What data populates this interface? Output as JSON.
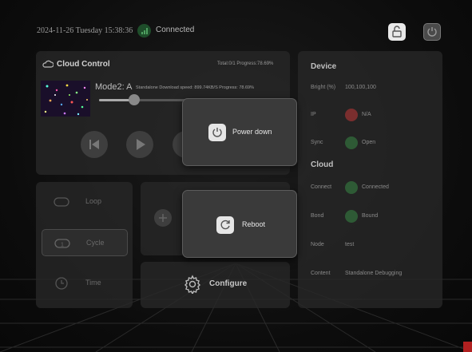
{
  "header": {
    "datetime": "2024-11-26 Tuesday 15:38:36",
    "connection": "Connected"
  },
  "cloud_control": {
    "title": "Cloud Control",
    "total_progress": "Total:0/1  Progress:78.69%",
    "mode_label": "Mode2: A",
    "mode_detail": "Standalone Download speed: 899.74KB/S Progress: 78.69%",
    "progress": 0.21
  },
  "modes": [
    {
      "label": "Loop",
      "icon": "loop-icon"
    },
    {
      "label": "Cycle",
      "icon": "cycle-icon"
    },
    {
      "label": "Time",
      "icon": "clock-icon"
    }
  ],
  "configure": {
    "label": "Configure"
  },
  "device": {
    "title": "Device",
    "bright_label": "Bright (%)",
    "bright_value": "100,100,100",
    "ip_label": "IP",
    "ip_value": "N/A",
    "sync_label": "Sync",
    "sync_value": "Open"
  },
  "cloud": {
    "title": "Cloud",
    "connect_label": "Connect",
    "connect_value": "Connected",
    "bond_label": "Bond",
    "bond_value": "Bound",
    "node_label": "Node",
    "node_value": "test",
    "content_label": "Content",
    "content_value": "Standalone Debugging"
  },
  "popups": {
    "power_down": "Power down",
    "reboot": "Reboot"
  },
  "colors": {
    "status_red": "#7a2e2e",
    "status_green": "#2e5a35"
  }
}
